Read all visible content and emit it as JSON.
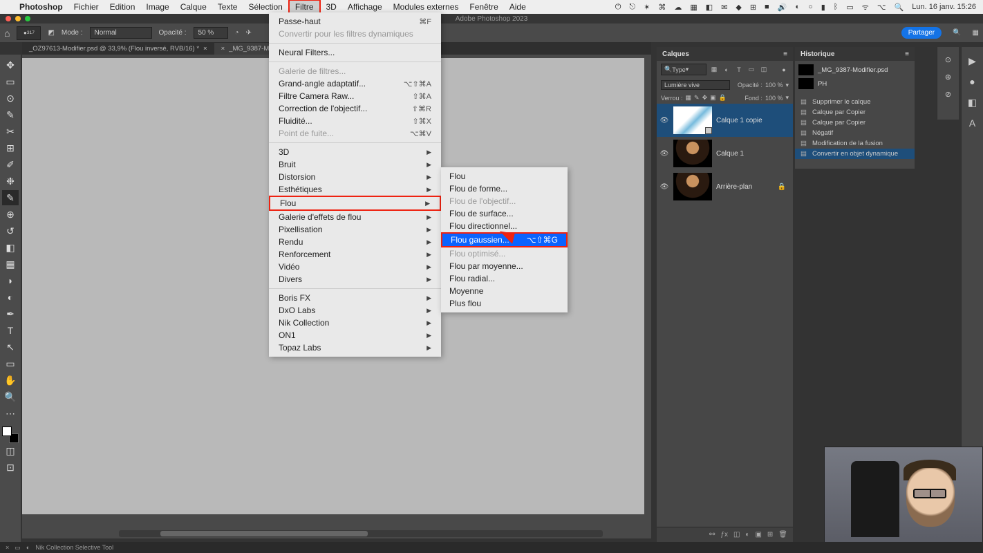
{
  "mac_menu": {
    "app": "Photoshop",
    "items": [
      "Fichier",
      "Edition",
      "Image",
      "Calque",
      "Texte",
      "Sélection",
      "Filtre",
      "3D",
      "Affichage",
      "Modules externes",
      "Fenêtre",
      "Aide"
    ],
    "open_index": 6,
    "right_text": "Lun. 16 janv.  15:26"
  },
  "window_title": "Adobe Photoshop 2023",
  "options_bar": {
    "size_label": "317",
    "mode_label": "Mode :",
    "mode_value": "Normal",
    "opacity_label": "Opacité :",
    "opacity_value": "50 %",
    "share_label": "Partager"
  },
  "tabs": [
    {
      "label": "_OZ97613-Modifier.psd @ 33,9% (Flou inversé, RVB/16) *",
      "active": false
    },
    {
      "label": "_MG_9387-Modifi…",
      "active": true
    }
  ],
  "filter_menu": {
    "items": [
      {
        "label": "Passe-haut",
        "short": "⌘F"
      },
      {
        "label": "Convertir pour les filtres dynamiques",
        "disabled": true,
        "sep_after": true
      },
      {
        "label": "Neural Filters...",
        "sep_after": true
      },
      {
        "label": "Galerie de filtres...",
        "disabled": true
      },
      {
        "label": "Grand-angle adaptatif...",
        "short": "⌥⇧⌘A"
      },
      {
        "label": "Filtre Camera Raw...",
        "short": "⇧⌘A"
      },
      {
        "label": "Correction de l'objectif...",
        "short": "⇧⌘R"
      },
      {
        "label": "Fluidité...",
        "short": "⇧⌘X"
      },
      {
        "label": "Point de fuite...",
        "short": "⌥⌘V",
        "disabled": true,
        "sep_after": true
      },
      {
        "label": "3D",
        "arrow": true
      },
      {
        "label": "Bruit",
        "arrow": true
      },
      {
        "label": "Distorsion",
        "arrow": true
      },
      {
        "label": "Esthétiques",
        "arrow": true
      },
      {
        "label": "Flou",
        "arrow": true,
        "boxed": true
      },
      {
        "label": "Galerie d'effets de flou",
        "arrow": true
      },
      {
        "label": "Pixellisation",
        "arrow": true
      },
      {
        "label": "Rendu",
        "arrow": true
      },
      {
        "label": "Renforcement",
        "arrow": true
      },
      {
        "label": "Vidéo",
        "arrow": true
      },
      {
        "label": "Divers",
        "arrow": true,
        "sep_after": true
      },
      {
        "label": "Boris FX",
        "arrow": true
      },
      {
        "label": "DxO Labs",
        "arrow": true
      },
      {
        "label": "Nik Collection",
        "arrow": true
      },
      {
        "label": "ON1",
        "arrow": true
      },
      {
        "label": "Topaz Labs",
        "arrow": true
      }
    ]
  },
  "flou_submenu": [
    {
      "label": "Flou"
    },
    {
      "label": "Flou de forme..."
    },
    {
      "label": "Flou de l'objectif...",
      "disabled": true
    },
    {
      "label": "Flou de surface..."
    },
    {
      "label": "Flou directionnel..."
    },
    {
      "label": "Flou gaussien...",
      "short": "⌥⇧⌘G",
      "hl": true
    },
    {
      "label": "Flou optimisé...",
      "disabled": true
    },
    {
      "label": "Flou par moyenne..."
    },
    {
      "label": "Flou radial..."
    },
    {
      "label": "Moyenne"
    },
    {
      "label": "Plus flou"
    }
  ],
  "layers_panel": {
    "title": "Calques",
    "type_filter": "Type",
    "blend_mode": "Lumière vive",
    "opacity_label": "Opacité :",
    "opacity_value": "100 %",
    "lock_label": "Verrou :",
    "fill_label": "Fond :",
    "fill_value": "100 %",
    "layers": [
      {
        "name": "Calque 1 copie",
        "selected": true,
        "smart": true,
        "thumb": "layer1copie"
      },
      {
        "name": "Calque 1",
        "thumb": "photo"
      },
      {
        "name": "Arrière-plan",
        "locked": true,
        "thumb": "photo"
      }
    ]
  },
  "history_panel": {
    "title": "Historique",
    "snapshots": [
      {
        "name": "_MG_9387-Modifier.psd"
      },
      {
        "name": "PH"
      }
    ],
    "steps": [
      {
        "label": "Supprimer le calque"
      },
      {
        "label": "Calque par Copier"
      },
      {
        "label": "Calque par Copier"
      },
      {
        "label": "Négatif"
      },
      {
        "label": "Modification de la fusion"
      },
      {
        "label": "Convertir en objet dynamique",
        "selected": true
      }
    ]
  },
  "statusbar": {
    "tool": "Nik Collection Selective Tool"
  }
}
